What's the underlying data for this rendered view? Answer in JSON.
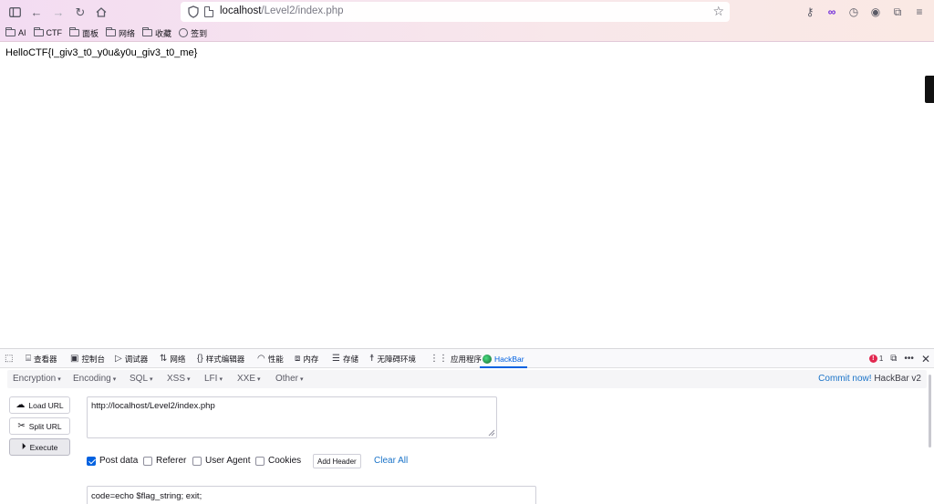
{
  "browser": {
    "url_host": "localhost",
    "url_path": "/Level2/index.php",
    "bookmarks": [
      {
        "label": "AI",
        "icon": "folder-icon"
      },
      {
        "label": "CTF",
        "icon": "folder-icon"
      },
      {
        "label": "面板",
        "icon": "folder-icon"
      },
      {
        "label": "网络",
        "icon": "folder-icon"
      },
      {
        "label": "收藏",
        "icon": "folder-icon"
      },
      {
        "label": "签到",
        "icon": "globe-icon"
      }
    ]
  },
  "page": {
    "flag_text": "HelloCTF{I_giv3_t0_y0u&y0u_giv3_t0_me}"
  },
  "devtools": {
    "tabs": [
      {
        "label": "查看器",
        "icon": "inspector-icon"
      },
      {
        "label": "控制台",
        "icon": "console-icon"
      },
      {
        "label": "调试器",
        "icon": "debugger-icon"
      },
      {
        "label": "网络",
        "icon": "network-icon"
      },
      {
        "label": "样式编辑器",
        "icon": "style-editor-icon"
      },
      {
        "label": "性能",
        "icon": "performance-icon"
      },
      {
        "label": "内存",
        "icon": "memory-icon"
      },
      {
        "label": "存储",
        "icon": "storage-icon"
      },
      {
        "label": "无障碍环境",
        "icon": "accessibility-icon"
      },
      {
        "label": "应用程序",
        "icon": "application-icon"
      },
      {
        "label": "HackBar",
        "icon": "hackbar-icon"
      }
    ],
    "error_count": "1"
  },
  "hackbar": {
    "menu": [
      "Encryption",
      "Encoding",
      "SQL",
      "XSS",
      "LFI",
      "XXE",
      "Other"
    ],
    "commit_link": "Commit now!",
    "version": "HackBar v2",
    "buttons": {
      "load_url": "Load URL",
      "split_url": "Split URL",
      "execute": "Execute"
    },
    "url_value": "http://localhost/Level2/index.php",
    "options": {
      "post_data": "Post data",
      "referer": "Referer",
      "user_agent": "User Agent",
      "cookies": "Cookies"
    },
    "add_header": "Add Header",
    "clear_all": "Clear All",
    "post_value": "code=echo $flag_string; exit;"
  }
}
